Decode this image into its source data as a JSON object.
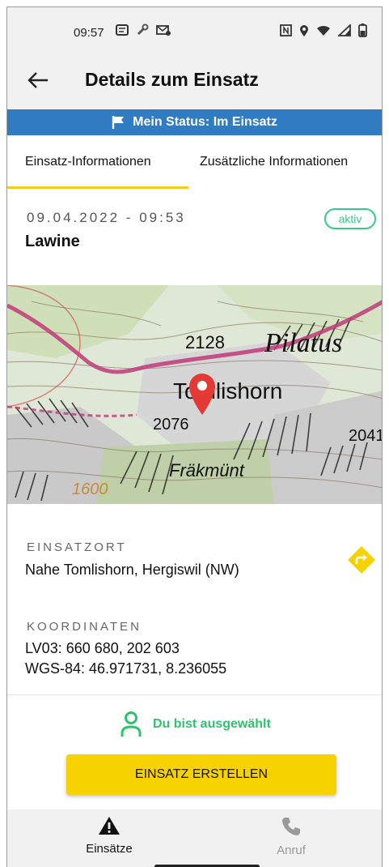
{
  "status_bar": {
    "time": "09:57"
  },
  "app_bar": {
    "title": "Details zum Einsatz"
  },
  "status_banner": {
    "text": "Mein Status: Im Einsatz"
  },
  "tabs": [
    {
      "label": "Einsatz-Informationen",
      "active": true
    },
    {
      "label": "Zusätzliche Informationen",
      "active": false
    }
  ],
  "incident": {
    "datetime": "09.04.2022 - 09:53",
    "badge": "aktiv",
    "type": "Lawine"
  },
  "map": {
    "labels": [
      "2128",
      "Pilatus",
      "Tomlishorn",
      "2076",
      "2041",
      "Fräkmünt",
      "1600"
    ]
  },
  "location": {
    "label": "EINSATZORT",
    "value": "Nahe Tomlishorn, Hergiswil (NW)"
  },
  "coordinates": {
    "label": "KOORDINATEN",
    "lv03": "LV03: 660 680, 202 603",
    "wgs84": "WGS-84: 46.971731, 8.236055"
  },
  "selection": {
    "text": "Du bist ausgewählt"
  },
  "actions": {
    "create_label": "EINSATZ ERSTELLEN"
  },
  "bottom_nav": [
    {
      "label": "Einsätze",
      "icon": "warning-icon",
      "active": true
    },
    {
      "label": "Anruf",
      "icon": "phone-icon",
      "active": false
    }
  ],
  "colors": {
    "banner": "#2f7cc3",
    "accent_yellow": "#f6d300",
    "tab_indicator": "#f2cd1c",
    "active_green": "#3cc988",
    "selected_green": "#2fc26e",
    "map_pin": "#e53935"
  }
}
